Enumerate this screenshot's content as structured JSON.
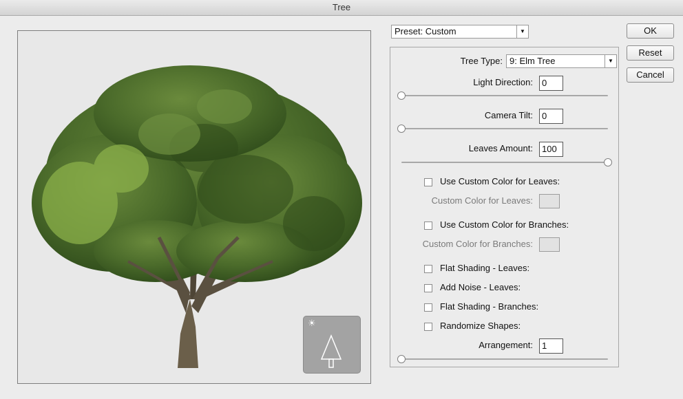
{
  "window": {
    "title": "Tree"
  },
  "preset": {
    "value": "Preset: Custom"
  },
  "buttons": {
    "ok": "OK",
    "reset": "Reset",
    "cancel": "Cancel"
  },
  "params": {
    "tree_type_label": "Tree Type:",
    "tree_type_value": "9: Elm Tree",
    "light_direction_label": "Light Direction:",
    "light_direction_value": "0",
    "camera_tilt_label": "Camera Tilt:",
    "camera_tilt_value": "0",
    "leaves_amount_label": "Leaves Amount:",
    "leaves_amount_value": "100",
    "custom_leaves_check": "Use Custom Color for Leaves:",
    "custom_leaves_label": "Custom Color for Leaves:",
    "custom_branches_check": "Use Custom Color for Branches:",
    "custom_branches_label": "Custom Color for Branches:",
    "flat_leaves": "Flat Shading - Leaves:",
    "noise_leaves": "Add Noise - Leaves:",
    "flat_branches": "Flat Shading - Branches:",
    "randomize": "Randomize Shapes:",
    "arrangement_label": "Arrangement:",
    "arrangement_value": "1"
  },
  "sliders": {
    "light_direction": 0,
    "camera_tilt": 0,
    "leaves_amount": 1.0,
    "arrangement": 0
  },
  "icons": {
    "light": "sun-icon",
    "tree_nav": "tree-outline-icon",
    "dropdown": "chevron-down-icon"
  },
  "colors": {
    "foliage_dark": "#3f5a24",
    "foliage_mid": "#5a7a34",
    "foliage_light": "#8bb04a",
    "trunk": "#6b5f4a"
  }
}
